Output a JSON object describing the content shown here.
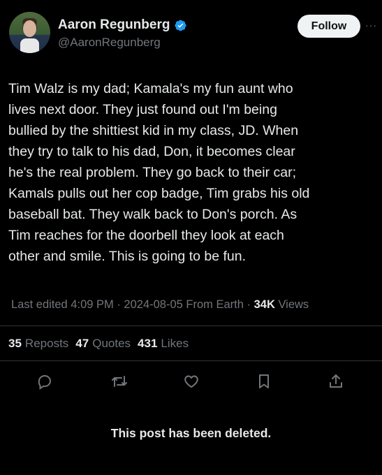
{
  "author": {
    "display_name": "Aaron Regunberg",
    "handle": "@AaronRegunberg",
    "verified": true
  },
  "header": {
    "follow_label": "Follow",
    "more_label": "···"
  },
  "tweet": {
    "text": "Tim Walz is my dad; Kamala's my fun aunt who\nlives next door. They just found out I'm being\nbullied by the shittiest kid in my class, JD. When\nthey try to talk to his dad, Don, it becomes clear\nhe's the real problem. They go back to their car;\nKamals pulls out her cop badge, Tim grabs his old\nbaseball bat. They walk back to Don's porch. As\nTim reaches for the doorbell they look at each\nother and smile. This is going to be fun."
  },
  "meta": {
    "edited": "Last edited 4:09 PM · 2024-08-05 From Earth · ",
    "views_count": "34K",
    "views_label": " Views"
  },
  "stats": {
    "reposts_count": "35",
    "reposts_label": "Reposts",
    "quotes_count": "47",
    "quotes_label": "Quotes",
    "likes_count": "431",
    "likes_label": "Likes"
  },
  "actions": [
    "reply-icon",
    "repost-icon",
    "like-icon",
    "bookmark-icon",
    "share-icon"
  ],
  "notice": "This post has been deleted.",
  "colors": {
    "background": "#000000",
    "text": "#e7e9ea",
    "muted": "#71767b",
    "verified": "#1d9bf0",
    "divider": "#2f3336"
  }
}
